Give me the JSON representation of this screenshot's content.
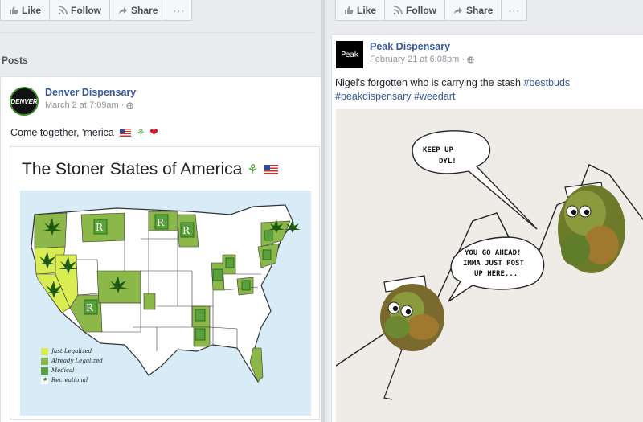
{
  "left_post": {
    "actions": {
      "like": "Like",
      "follow": "Follow",
      "share": "Share",
      "more": "···"
    },
    "posts_heading": "Posts",
    "page_name": "Denver Dispensary",
    "avatar_text": "DENVER",
    "timestamp": "March 2 at 7:09am ·",
    "text": "Come together, 'merica",
    "map_title": "The Stoner States of America",
    "legend": [
      {
        "label": "Just Legalized",
        "color": "#d9ec52"
      },
      {
        "label": "Already Legalized",
        "color": "#8cb84a"
      },
      {
        "label": "Medical",
        "color": "#5aa03c"
      },
      {
        "label": "Recreational",
        "color": "#2c6e1e"
      }
    ],
    "rx_label": "Rx"
  },
  "right_post": {
    "actions": {
      "like": "Like",
      "follow": "Follow",
      "share": "Share",
      "more": "···"
    },
    "page_name": "Peak Dispensary",
    "avatar_text": "Peak",
    "timestamp": "February 21 at 6:08pm ·",
    "text": "Nigel's forgotten who is carrying the stash",
    "hashtags": [
      "#bestbuds",
      "#peakdispensary",
      "#weedart"
    ],
    "bubble1": [
      "KEEP UP",
      "DYL!"
    ],
    "bubble2": [
      "YOU GO AHEAD!",
      "IMMA JUST POST",
      "UP HERE..."
    ]
  },
  "colors": {
    "link": "#365899",
    "background": "#e9ebee",
    "map_water": "#d7ecf7",
    "state_fill": "#ffffff",
    "just_legalized": "#d9ec52",
    "already_legalized": "#8cb84a"
  }
}
